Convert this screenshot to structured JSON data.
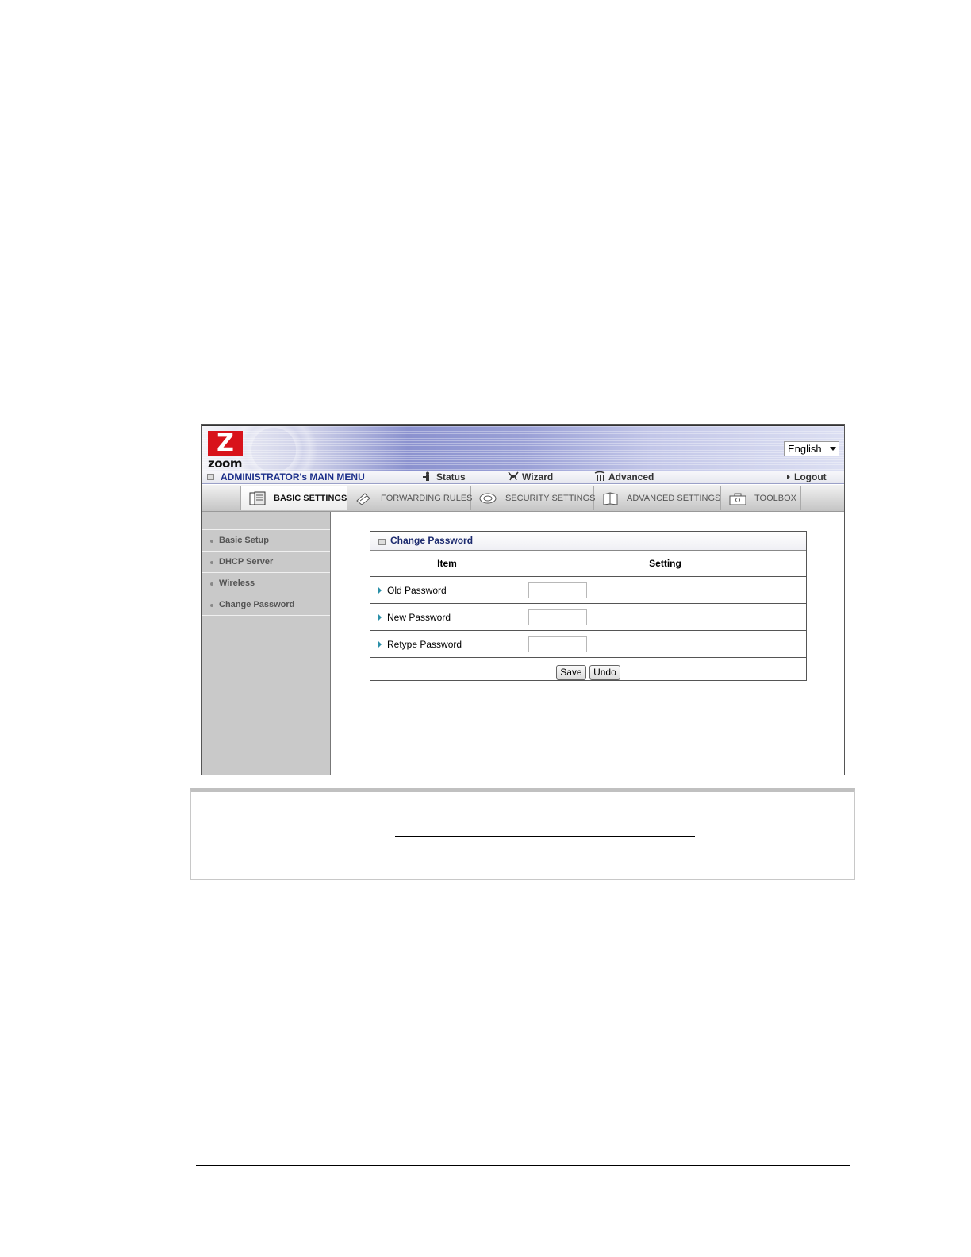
{
  "router_ui": {
    "language": "English",
    "logo": {
      "letter": "Z",
      "word": "zoom"
    },
    "menubar": {
      "title": "ADMINISTRATOR's MAIN MENU",
      "status": "Status",
      "wizard": "Wizard",
      "advanced": "Advanced",
      "logout": "Logout"
    },
    "tabs": [
      {
        "label": "BASIC SETTINGS",
        "active": true
      },
      {
        "label": "FORWARDING RULES"
      },
      {
        "label": "SECURITY SETTINGS"
      },
      {
        "label": "ADVANCED SETTINGS"
      },
      {
        "label": "TOOLBOX"
      }
    ],
    "sidebar": [
      {
        "label": "Basic Setup"
      },
      {
        "label": "DHCP Server"
      },
      {
        "label": "Wireless"
      },
      {
        "label": "Change Password"
      }
    ],
    "panel": {
      "title": "Change Password",
      "col_item": "Item",
      "col_setting": "Setting",
      "rows": [
        {
          "label": "Old Password",
          "value": ""
        },
        {
          "label": "New Password",
          "value": ""
        },
        {
          "label": "Retype Password",
          "value": ""
        }
      ],
      "save_label": "Save",
      "undo_label": "Undo"
    }
  },
  "colors": {
    "brand_red": "#d8121a",
    "menu_title_blue": "#1c2f8a",
    "arrow_teal": "#2a8fa8"
  }
}
